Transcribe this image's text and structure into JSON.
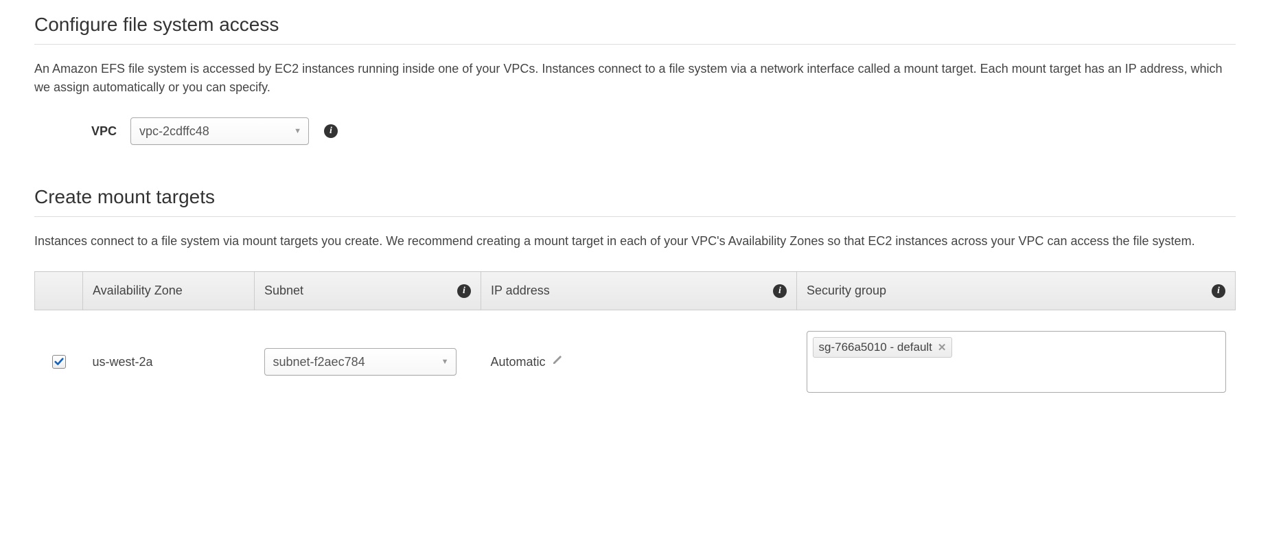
{
  "section1": {
    "heading": "Configure file system access",
    "description": "An Amazon EFS file system is accessed by EC2 instances running inside one of your VPCs. Instances connect to a file system via a network interface called a mount target. Each mount target has an IP address, which we assign automatically or you can specify.",
    "vpc_label": "VPC",
    "vpc_selected": "vpc-2cdffc48"
  },
  "section2": {
    "heading": "Create mount targets",
    "description": "Instances connect to a file system via mount targets you create. We recommend creating a mount target in each of your VPC's Availability Zones so that EC2 instances across your VPC can access the file system."
  },
  "table": {
    "headers": {
      "az": "Availability Zone",
      "subnet": "Subnet",
      "ip": "IP address",
      "sg": "Security group"
    },
    "rows": [
      {
        "checked": true,
        "az": "us-west-2a",
        "subnet": "subnet-f2aec784",
        "ip": "Automatic",
        "sg_tag": "sg-766a5010 - default"
      }
    ]
  }
}
